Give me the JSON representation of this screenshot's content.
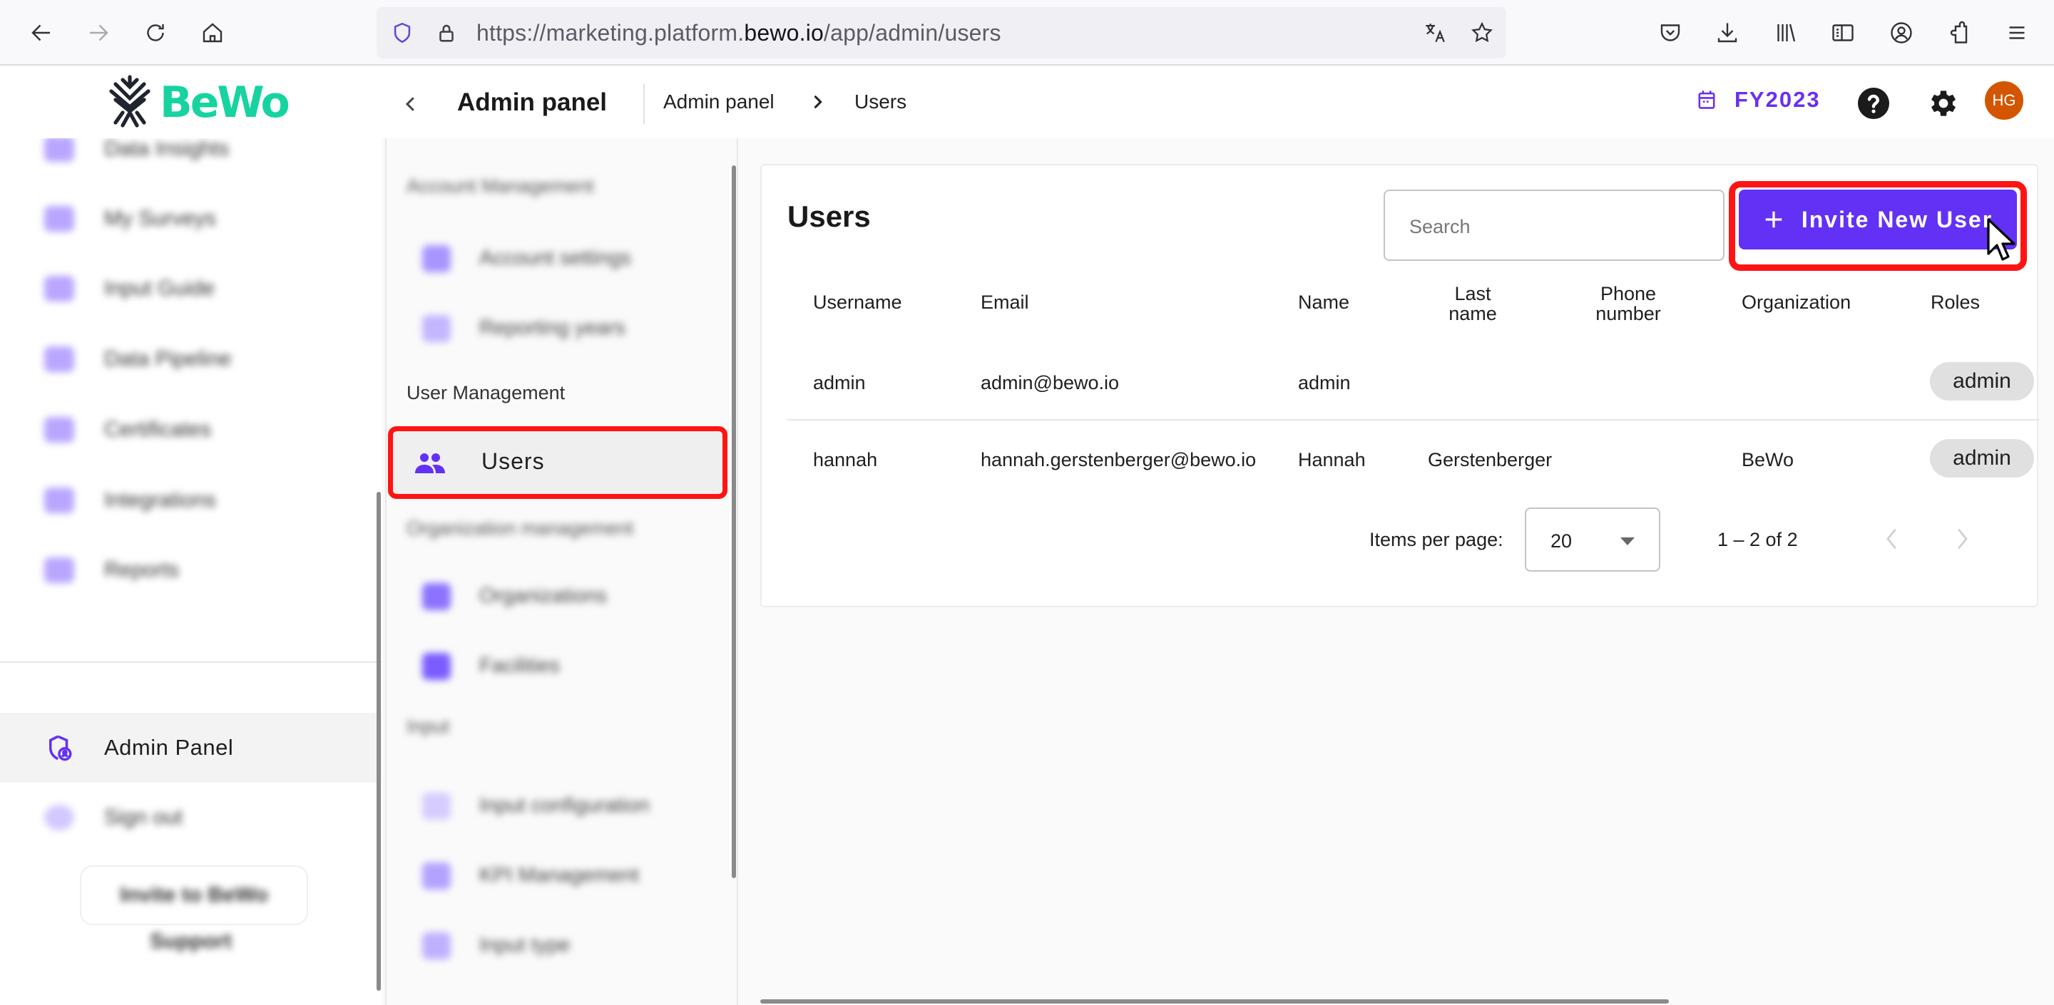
{
  "browser": {
    "url_prefix": "https://marketing.platform.",
    "url_host": "bewo.io",
    "url_path": "/app/admin/users",
    "nav_icons": [
      "back-icon",
      "forward-icon",
      "reload-icon",
      "home-icon"
    ],
    "url_icons": [
      "shield-icon",
      "lock-icon",
      "translate-icon",
      "bookmark-star-icon"
    ],
    "toolbar_icons": [
      "pocket-icon",
      "downloads-icon",
      "library-icon",
      "sidebar-icon",
      "account-icon",
      "extensions-icon",
      "menu-icon"
    ]
  },
  "header": {
    "logo_text": "BeWo",
    "page_title": "Admin panel",
    "breadcrumb": [
      "Admin panel",
      "Users"
    ],
    "fiscal_year": "FY2023",
    "avatar_initials": "HG"
  },
  "colors": {
    "accent": "#6231f5",
    "brand_green": "#17d3a0",
    "highlight_outline": "#ff1414",
    "avatar": "#d45500"
  },
  "sidebar": {
    "items": [
      {
        "label": "Data Insights",
        "blurred": true
      },
      {
        "label": "My Surveys",
        "blurred": true
      },
      {
        "label": "Input Guide",
        "blurred": true
      },
      {
        "label": "Data Pipeline",
        "blurred": true
      },
      {
        "label": "Certificates",
        "blurred": true
      },
      {
        "label": "Integrations",
        "blurred": true
      },
      {
        "label": "Reports",
        "blurred": true
      }
    ],
    "admin_panel": "Admin Panel",
    "sign_out": "Sign out",
    "invite_button": "Invite to BeWo",
    "support": "Support"
  },
  "subnav": {
    "account_heading": "Account Management",
    "account_items": [
      "Account settings",
      "Reporting years"
    ],
    "user_heading": "User Management",
    "users_item": "Users",
    "org_heading": "Organization management",
    "org_items": [
      "Organizations",
      "Facilities"
    ],
    "input_heading": "Input",
    "input_items": [
      "Input configuration",
      "KPI Management",
      "Input type"
    ]
  },
  "users_page": {
    "title": "Users",
    "search_placeholder": "Search",
    "invite_button": "Invite New User",
    "columns": [
      "Username",
      "Email",
      "Name",
      "Last\nname",
      "Phone\nnumber",
      "Organization",
      "Roles"
    ],
    "rows": [
      {
        "username": "admin",
        "email": "admin@bewo.io",
        "name": "admin",
        "last_name": "",
        "phone": "",
        "organization": "",
        "role": "admin"
      },
      {
        "username": "hannah",
        "email": "hannah.gerstenberger@bewo.io",
        "name": "Hannah",
        "last_name": "Gerstenberger",
        "phone": "",
        "organization": "BeWo",
        "role": "admin"
      }
    ],
    "paginator": {
      "items_per_page_label": "Items per page:",
      "items_per_page": "20",
      "range": "1 – 2 of 2"
    }
  }
}
